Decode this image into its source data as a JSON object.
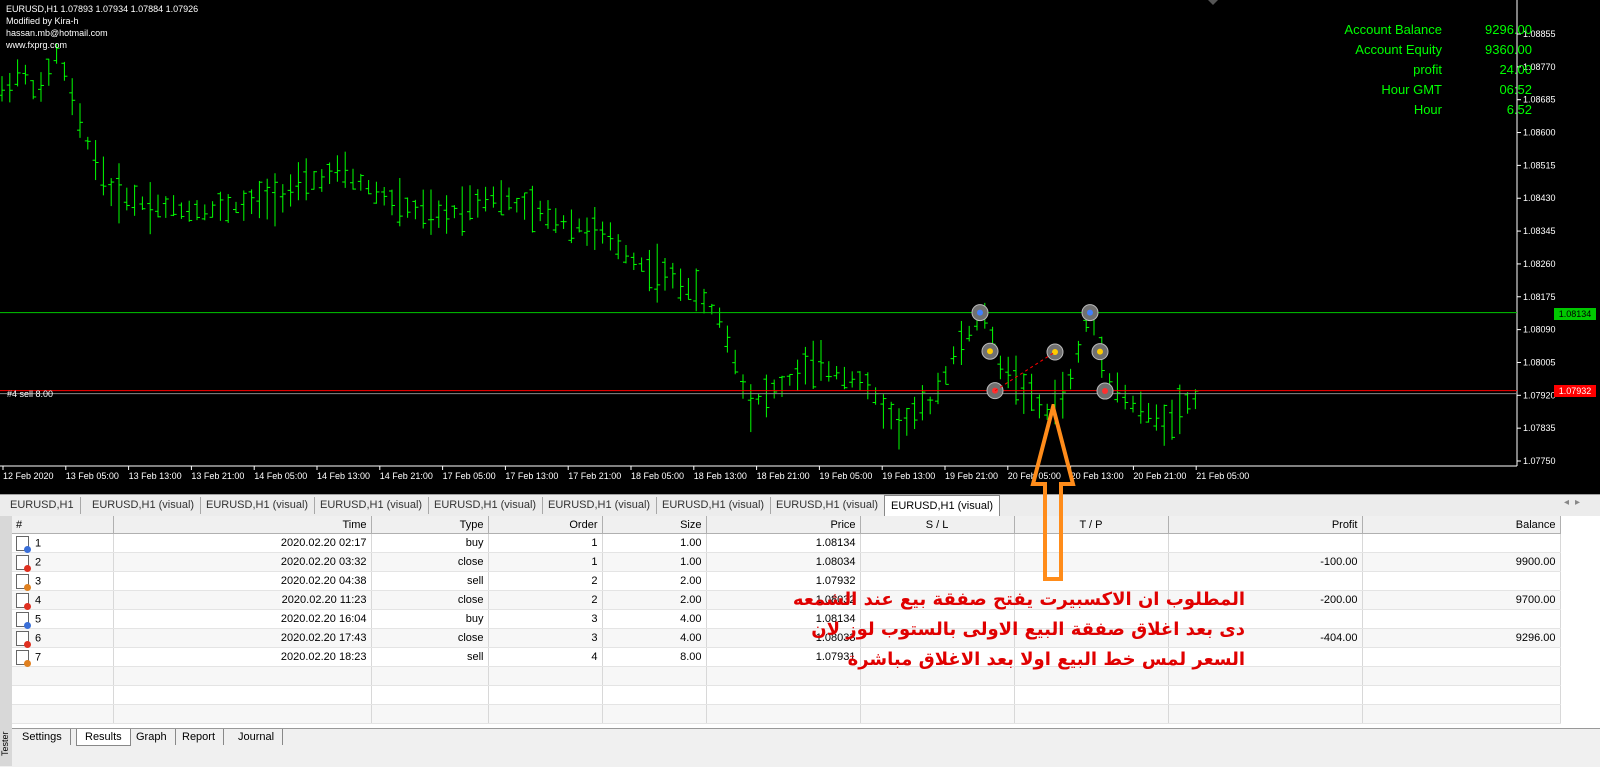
{
  "chart": {
    "symbol_line": "EURUSD,H1  1.07893 1.07934 1.07884 1.07926",
    "info_lines": [
      "Modified by Kira-h",
      "hassan.mb@hotmail.com",
      "www.fxprg.com"
    ],
    "account": [
      {
        "label": "Account Balance",
        "value": "9296.00"
      },
      {
        "label": "Account Equity",
        "value": "9360.00"
      },
      {
        "label": "profit",
        "value": "24.00"
      },
      {
        "label": "Hour GMT",
        "value": "06:52"
      },
      {
        "label": "Hour",
        "value": "6.52"
      }
    ],
    "price_axis": [
      "1.08855",
      "1.08770",
      "1.08685",
      "1.08600",
      "1.08515",
      "1.08430",
      "1.08345",
      "1.08260",
      "1.08175",
      "1.08090",
      "1.08005",
      "1.07920",
      "1.07835",
      "1.07750"
    ],
    "time_axis": [
      "12 Feb 2020",
      "13 Feb 05:00",
      "13 Feb 13:00",
      "13 Feb 21:00",
      "14 Feb 05:00",
      "14 Feb 13:00",
      "14 Feb 21:00",
      "17 Feb 05:00",
      "17 Feb 13:00",
      "17 Feb 21:00",
      "18 Feb 05:00",
      "18 Feb 13:00",
      "18 Feb 21:00",
      "19 Feb 05:00",
      "19 Feb 13:00",
      "19 Feb 21:00",
      "20 Feb 05:00",
      "20 Feb 13:00",
      "20 Feb 21:00",
      "21 Feb 05:00"
    ],
    "order_label": "#4 sell 8.00",
    "buy_line_price": "1.08134",
    "sell_line_price": "1.07932",
    "colors": {
      "background": "#000000",
      "bars": "#00ff00",
      "buy_line": "#00c800",
      "sell_line": "#ff0000",
      "text": "#ffffff"
    }
  },
  "chart_tabs": [
    "EURUSD,H1",
    "EURUSD,H1 (visual)",
    "EURUSD,H1 (visual)",
    "EURUSD,H1 (visual)",
    "EURUSD,H1 (visual)",
    "EURUSD,H1 (visual)",
    "EURUSD,H1 (visual)",
    "EURUSD,H1 (visual)",
    "EURUSD,H1 (visual)"
  ],
  "results": {
    "columns": [
      "#",
      "Time",
      "Type",
      "Order",
      "Size",
      "Price",
      "S / L",
      "T / P",
      "Profit",
      "Balance"
    ],
    "rows": [
      {
        "n": "1",
        "time": "2020.02.20 02:17",
        "type": "buy",
        "order": "1",
        "size": "1.00",
        "price": "1.08134",
        "sl": "",
        "tp": "",
        "profit": "",
        "balance": ""
      },
      {
        "n": "2",
        "time": "2020.02.20 03:32",
        "type": "close",
        "order": "1",
        "size": "1.00",
        "price": "1.08034",
        "sl": "",
        "tp": "",
        "profit": "-100.00",
        "balance": "9900.00"
      },
      {
        "n": "3",
        "time": "2020.02.20 04:38",
        "type": "sell",
        "order": "2",
        "size": "2.00",
        "price": "1.07932",
        "sl": "",
        "tp": "",
        "profit": "",
        "balance": ""
      },
      {
        "n": "4",
        "time": "2020.02.20 11:23",
        "type": "close",
        "order": "2",
        "size": "2.00",
        "price": "1.08032",
        "sl": "",
        "tp": "",
        "profit": "-200.00",
        "balance": "9700.00"
      },
      {
        "n": "5",
        "time": "2020.02.20 16:04",
        "type": "buy",
        "order": "3",
        "size": "4.00",
        "price": "1.08134",
        "sl": "",
        "tp": "",
        "profit": "",
        "balance": ""
      },
      {
        "n": "6",
        "time": "2020.02.20 17:43",
        "type": "close",
        "order": "3",
        "size": "4.00",
        "price": "1.08033",
        "sl": "",
        "tp": "",
        "profit": "-404.00",
        "balance": "9296.00"
      },
      {
        "n": "7",
        "time": "2020.02.20 18:23",
        "type": "sell",
        "order": "4",
        "size": "8.00",
        "price": "1.07931",
        "sl": "",
        "tp": "",
        "profit": "",
        "balance": ""
      }
    ]
  },
  "tester_label": "Tester",
  "bottom_tabs": [
    "Settings",
    "Results",
    "Graph",
    "Report",
    "Journal"
  ],
  "annotation": {
    "lines": [
      "المطلوب ان الاكسبيرت يفتح صفقة بيع عند الشمعه",
      "دى بعد اغلاق صفقة البيع الاولى بالستوب لوز لان",
      "السعر لمس خط البيع اولا بعد الاغلاق مباشرة"
    ],
    "color": "#e00000",
    "arrow_color": "#ff8c1a"
  }
}
